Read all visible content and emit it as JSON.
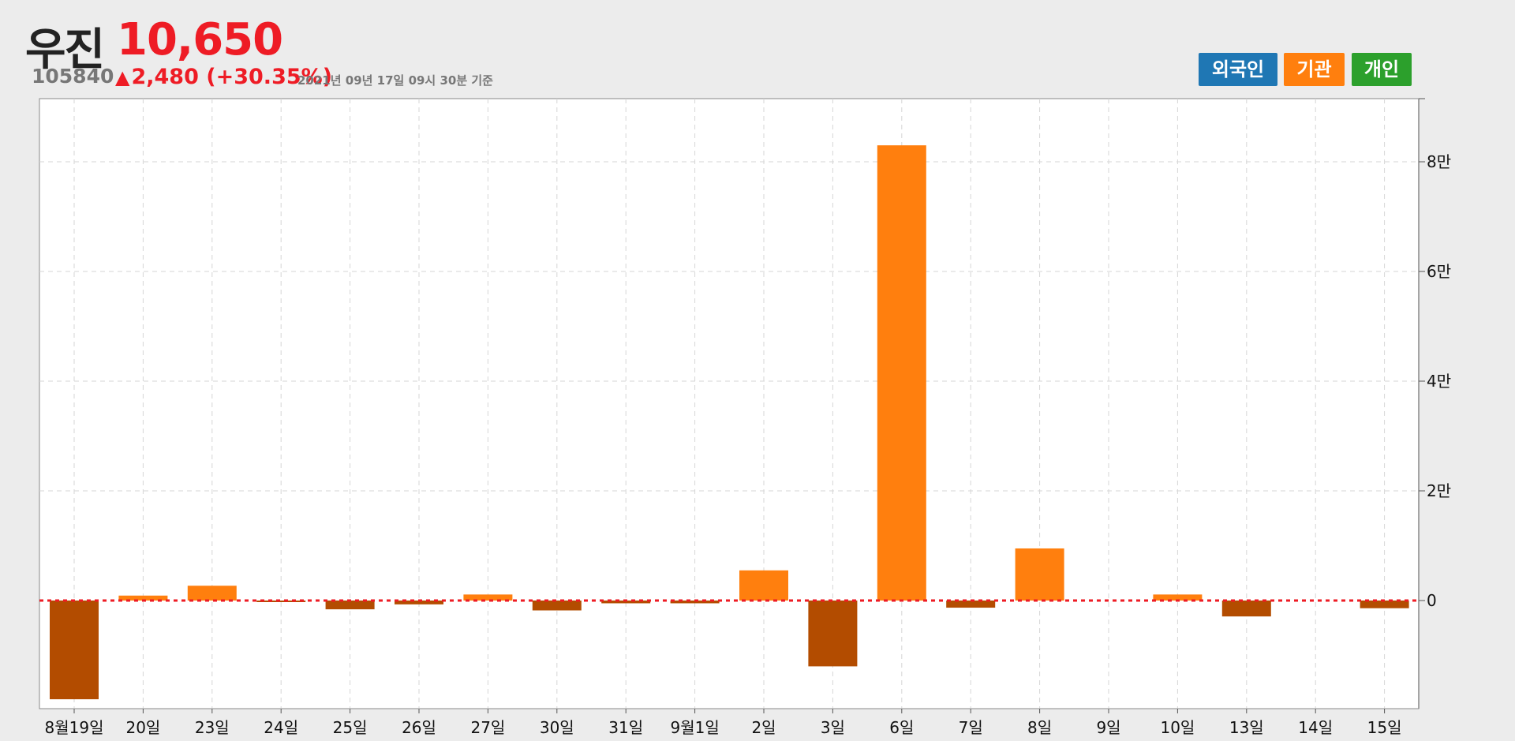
{
  "stock": {
    "name": "우진",
    "price": "10,650",
    "code": "105840",
    "change": "2,480 (+30.35%)",
    "change_color": "#ee1c25",
    "timestamp": "2021년 09년 17일 09시 30분 기준"
  },
  "legend": [
    {
      "label": "외국인",
      "color": "#1f77b4"
    },
    {
      "label": "기관",
      "color": "#ff7f0e"
    },
    {
      "label": "개인",
      "color": "#2ca02c"
    }
  ],
  "chart_data": {
    "type": "bar",
    "categories": [
      "8월19일",
      "20일",
      "23일",
      "24일",
      "25일",
      "26일",
      "27일",
      "30일",
      "31일",
      "9월1일",
      "2일",
      "3일",
      "6일",
      "7일",
      "8일",
      "9일",
      "10일",
      "13일",
      "14일",
      "15일"
    ],
    "series": [
      {
        "name": "기관",
        "values": [
          -18000,
          900,
          2700,
          -200,
          -1600,
          -700,
          1100,
          -1800,
          -500,
          -500,
          5500,
          -12000,
          83000,
          -1300,
          9500,
          0,
          1100,
          -2900,
          0,
          -1400
        ]
      }
    ],
    "positive_color": "#ff7f0e",
    "negative_color": "#b34c00",
    "baseline_color": "#ee1c25",
    "ylim": [
      -20000,
      90000
    ],
    "y_ticks": [
      0,
      20000,
      40000,
      60000,
      80000
    ],
    "y_tick_labels": [
      "0",
      "2만",
      "4만",
      "6만",
      "8만"
    ],
    "grid": true,
    "y_axis_position": "right",
    "legend_position": "top-right"
  }
}
